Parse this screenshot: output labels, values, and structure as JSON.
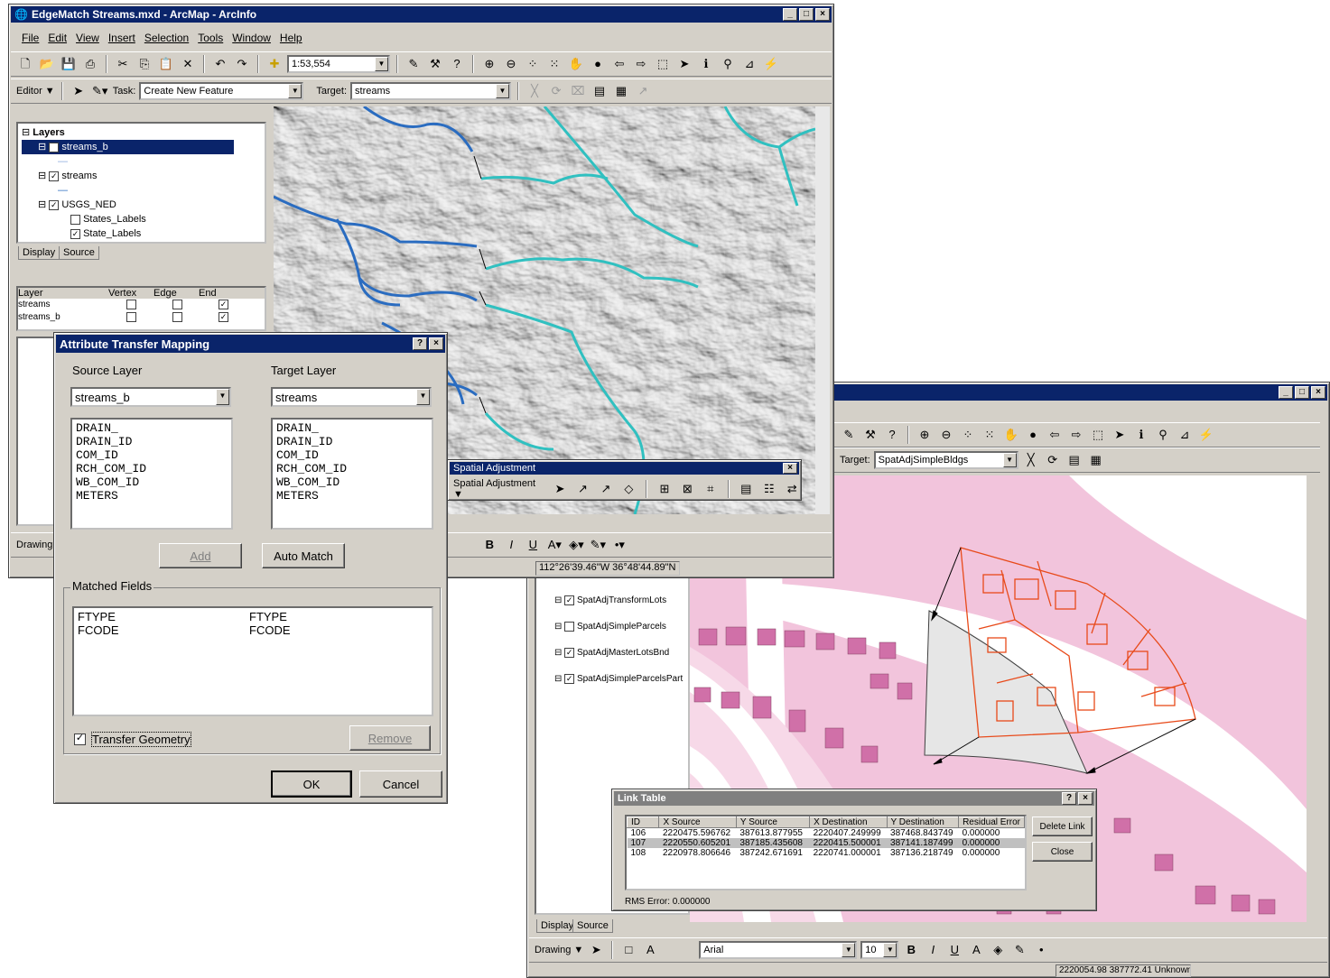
{
  "main": {
    "title": "EdgeMatch Streams.mxd - ArcMap - ArcInfo",
    "menus": [
      "File",
      "Edit",
      "View",
      "Insert",
      "Selection",
      "Tools",
      "Window",
      "Help"
    ],
    "scale": "1:53,554",
    "editor": "Editor ▼",
    "task_label": "Task:",
    "task_value": "Create New Feature",
    "target_label": "Target:",
    "target_value": "streams",
    "toc": {
      "root": "Layers",
      "layers": [
        "streams_b",
        "streams",
        "USGS_NED",
        "States_Labels",
        "State_Labels"
      ],
      "tabs": [
        "Display",
        "Source"
      ]
    },
    "snap": {
      "headers": [
        "Layer",
        "Vertex",
        "Edge",
        "End"
      ],
      "rows": [
        "streams",
        "streams_b"
      ]
    },
    "drawing": "Drawing",
    "coords": "112°26'39.46\"W  36°48'44.89\"N",
    "spatial_adj": {
      "title": "Spatial Adjustment",
      "menu": "Spatial Adjustment ▼"
    }
  },
  "dialog": {
    "title": "Attribute Transfer Mapping",
    "help": "?",
    "source_label": "Source Layer",
    "target_label": "Target Layer",
    "source_value": "streams_b",
    "target_value": "streams",
    "source_fields": [
      "DRAIN_",
      "DRAIN_ID",
      "COM_ID",
      "RCH_COM_ID",
      "WB_COM_ID",
      "METERS"
    ],
    "target_fields": [
      "DRAIN_",
      "DRAIN_ID",
      "COM_ID",
      "RCH_COM_ID",
      "WB_COM_ID",
      "METERS"
    ],
    "add": "Add",
    "auto_match": "Auto Match",
    "matched_label": "Matched Fields",
    "matched": [
      [
        "FTYPE",
        "FTYPE"
      ],
      [
        "FCODE",
        "FCODE"
      ]
    ],
    "transfer_geometry": "Transfer Geometry",
    "remove": "Remove",
    "ok": "OK",
    "cancel": "Cancel"
  },
  "second": {
    "target_label": "Target:",
    "target_value": "SpatAdjSimpleBldgs",
    "layers": [
      "SpatAdjTransformLots",
      "SpatAdjSimpleParcels",
      "SpatAdjMasterLotsBnd",
      "SpatAdjSimpleParcelsPart"
    ],
    "tabs": [
      "Display",
      "Source"
    ],
    "drawing": "Drawing ▼",
    "font": "Arial",
    "size": "10",
    "coords": "2220054.98  387772.41 Unknown"
  },
  "link_table": {
    "title": "Link Table",
    "help": "?",
    "headers": [
      "ID",
      "X Source",
      "Y Source",
      "X Destination",
      "Y Destination",
      "Residual Error"
    ],
    "rows": [
      [
        "106",
        "2220475.596762",
        "387613.877955",
        "2220407.249999",
        "387468.843749",
        "0.000000"
      ],
      [
        "107",
        "2220550.605201",
        "387185.435608",
        "2220415.500001",
        "387141.187499",
        "0.000000"
      ],
      [
        "108",
        "2220978.806646",
        "387242.671691",
        "2220741.000001",
        "387136.218749",
        "0.000000"
      ]
    ],
    "delete": "Delete Link",
    "close": "Close",
    "rms": "RMS Error:  0.000000"
  },
  "colors": {
    "title_bar": "#0a246a",
    "parcel": "#f2c4dc",
    "building": "#d070a8",
    "transform": "#e84a1a",
    "stream_dark": "#2a6cc0",
    "stream_light": "#30c0c0"
  }
}
